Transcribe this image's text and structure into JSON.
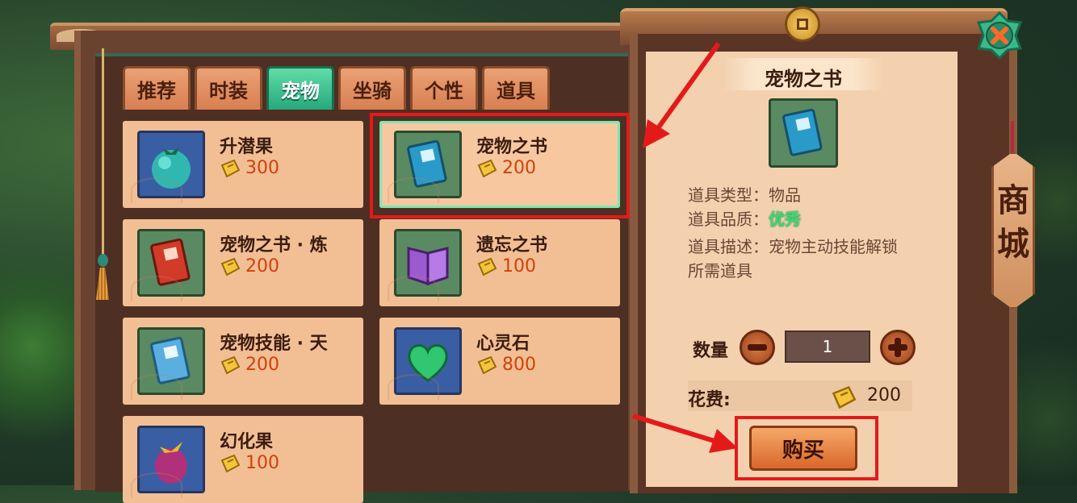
{
  "tabs": [
    {
      "label": "推荐",
      "active": false
    },
    {
      "label": "时装",
      "active": false
    },
    {
      "label": "宠物",
      "active": true
    },
    {
      "label": "坐骑",
      "active": false
    },
    {
      "label": "个性",
      "active": false
    },
    {
      "label": "道具",
      "active": false
    }
  ],
  "items": [
    {
      "name": "升潜果",
      "price": "300",
      "icon": "teal-fruit-icon"
    },
    {
      "name": "宠物之书",
      "price": "200",
      "icon": "pet-book-icon"
    },
    {
      "name": "宠物之书 · 炼",
      "price": "200",
      "icon": "red-pet-book-icon"
    },
    {
      "name": "遗忘之书",
      "price": "100",
      "icon": "purple-book-icon"
    },
    {
      "name": "宠物技能 · 天",
      "price": "200",
      "icon": "sky-skill-book-icon"
    },
    {
      "name": "心灵石",
      "price": "800",
      "icon": "green-heart-stone-icon"
    },
    {
      "name": "幻化果",
      "price": "100",
      "icon": "purple-fruit-icon"
    }
  ],
  "detail": {
    "title": "宠物之书",
    "type_label": "道具类型：",
    "type_value": "物品",
    "quality_label": "道具品质：",
    "quality_value": "优秀",
    "desc_label": "道具描述：",
    "desc_value_line1": "宠物主动技能解锁",
    "desc_value_line2": "所需道具",
    "qty_label": "数量",
    "qty_value": "1",
    "cost_label": "花费:",
    "cost_value": "200",
    "buy_label": "购买"
  },
  "sign_text": [
    "商",
    "城"
  ],
  "colors": {
    "highlight": "#e41a1a",
    "active_tab": "#27a97d",
    "price": "#d1410b",
    "quality": "#3ed676"
  }
}
